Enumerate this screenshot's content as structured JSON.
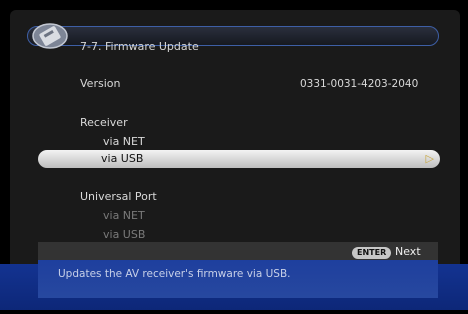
{
  "header": {
    "title": "7-7. Firmware Update"
  },
  "version": {
    "label": "Version",
    "value": "0331-0031-4203-2040"
  },
  "receiver": {
    "label": "Receiver",
    "items": [
      {
        "label": "via NET"
      },
      {
        "label": "via USB",
        "selected": true
      }
    ]
  },
  "universal_port": {
    "label": "Universal Port",
    "items": [
      {
        "label": "via NET",
        "enabled": false
      },
      {
        "label": "via USB",
        "enabled": false
      }
    ]
  },
  "footer": {
    "enter_badge": "ENTER",
    "next_label": "Next",
    "description": "Updates the AV receiver's firmware via USB."
  },
  "colors": {
    "accent_border": "#3e5fa6",
    "description_bg": "#1e3f9e",
    "selected_arrow": "#c7a640"
  },
  "icons": {
    "title_icon": "settings-tool-icon",
    "selection_arrow": "triangle-right-icon"
  }
}
